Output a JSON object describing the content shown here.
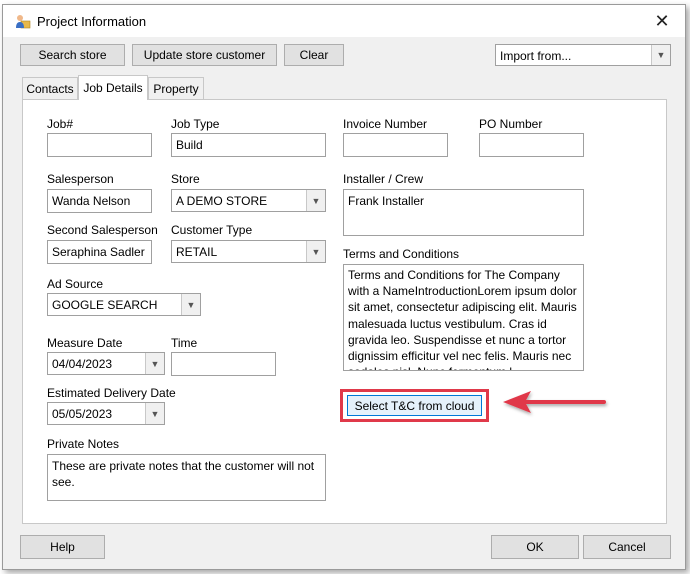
{
  "window": {
    "title": "Project Information",
    "close_glyph": "✕"
  },
  "toolbar": {
    "search_store": "Search store",
    "update_store_customer": "Update store customer",
    "clear": "Clear",
    "import_from": "Import from..."
  },
  "tabs": [
    {
      "label": "Contacts",
      "active": false
    },
    {
      "label": "Job Details",
      "active": true
    },
    {
      "label": "Property",
      "active": false
    }
  ],
  "fields": {
    "job_no": {
      "label": "Job#",
      "value": ""
    },
    "job_type": {
      "label": "Job Type",
      "value": "Build"
    },
    "invoice_number": {
      "label": "Invoice Number",
      "value": ""
    },
    "po_number": {
      "label": "PO Number",
      "value": ""
    },
    "salesperson": {
      "label": "Salesperson",
      "value": "Wanda Nelson"
    },
    "store": {
      "label": "Store",
      "value": "A DEMO STORE"
    },
    "installer": {
      "label": "Installer / Crew",
      "value": "Frank Installer"
    },
    "second_salesperson": {
      "label": "Second Salesperson",
      "value": "Seraphina Sadler"
    },
    "customer_type": {
      "label": "Customer Type",
      "value": "RETAIL"
    },
    "terms": {
      "label": "Terms and Conditions",
      "value": "Terms and Conditions for The Company with a NameIntroductionLorem ipsum dolor sit amet, consectetur adipiscing elit. Mauris malesuada luctus vestibulum. Cras id gravida leo. Suspendisse et nunc a tortor dignissim efficitur vel nec felis. Mauris nec sodales nisl. Nunc fermentum l"
    },
    "ad_source": {
      "label": "Ad Source",
      "value": "GOOGLE SEARCH"
    },
    "measure_date": {
      "label": "Measure Date",
      "value": "04/04/2023"
    },
    "time": {
      "label": "Time",
      "value": ""
    },
    "estimated_delivery": {
      "label": "Estimated Delivery Date",
      "value": "05/05/2023"
    },
    "private_notes": {
      "label": "Private Notes",
      "value": "These are private notes that the customer will not see."
    }
  },
  "select_tc_button": "Select T&C from cloud",
  "footer": {
    "help": "Help",
    "ok": "OK",
    "cancel": "Cancel"
  },
  "colors": {
    "highlight": "#e0394a",
    "arrow": "#e0394a"
  },
  "icons": {
    "app": "user-folder-icon",
    "close": "close-icon",
    "dropdown": "chevron-down-icon"
  }
}
